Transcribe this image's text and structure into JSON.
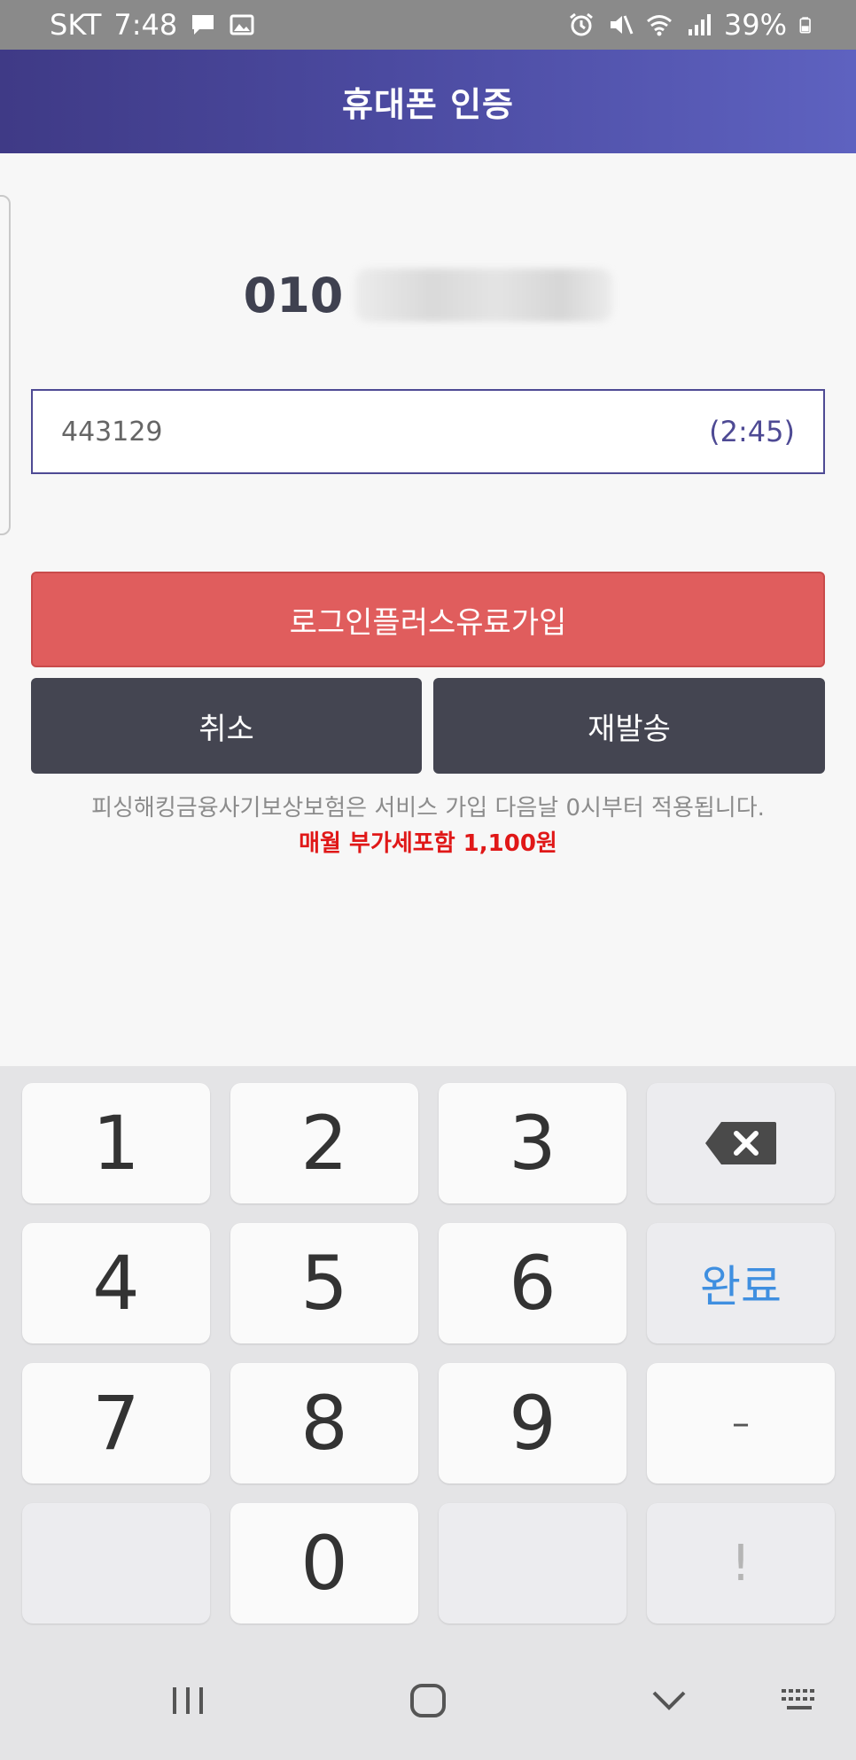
{
  "status_bar": {
    "carrier": "SKT",
    "time": "7:48",
    "battery": "39%",
    "icons": [
      "message-icon",
      "gallery-icon",
      "alarm-icon",
      "mute-icon",
      "wifi-icon",
      "signal-icon",
      "battery-icon"
    ]
  },
  "header": {
    "title": "휴대폰 인증"
  },
  "phone": {
    "prefix": "010"
  },
  "code_input": {
    "value": "443129",
    "timer": "(2:45)"
  },
  "buttons": {
    "subscribe": "로그인플러스유료가입",
    "cancel": "취소",
    "resend": "재발송"
  },
  "notice": {
    "text": "피싱해킹금융사기보상보험은 서비스 가입 다음날 0시부터 적용됩니다.",
    "price": "매월 부가세포함 1,100원"
  },
  "keypad": {
    "keys": [
      "1",
      "2",
      "3",
      "4",
      "5",
      "6",
      "7",
      "8",
      "9",
      "0"
    ],
    "done": "완료",
    "dash": "–",
    "exclaim": "!"
  },
  "colors": {
    "header_start": "#3f3a86",
    "header_end": "#5e62c0",
    "subscribe_button": "#e05d5d",
    "dark_button": "#444551",
    "price_text": "#e01818",
    "done_key": "#3f8fe0"
  }
}
